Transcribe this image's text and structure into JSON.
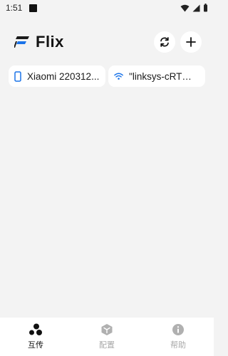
{
  "status_bar": {
    "time": "1:51",
    "icons": [
      "wifi-icon",
      "signal-icon",
      "battery-icon"
    ]
  },
  "app": {
    "name": "Flix",
    "accent": "#1a73e8"
  },
  "header": {
    "actions": [
      {
        "icon": "refresh-icon"
      },
      {
        "icon": "add-icon"
      }
    ]
  },
  "chips": {
    "device_label": "Xiaomi 220312...",
    "wifi_label": "\"linksys-cRTmA..."
  },
  "bottom_nav": {
    "items": [
      {
        "label": "互传",
        "icon": "share-dots-icon",
        "active": true
      },
      {
        "label": "配置",
        "icon": "cube-icon",
        "active": false
      },
      {
        "label": "帮助",
        "icon": "info-icon",
        "active": false
      }
    ]
  }
}
